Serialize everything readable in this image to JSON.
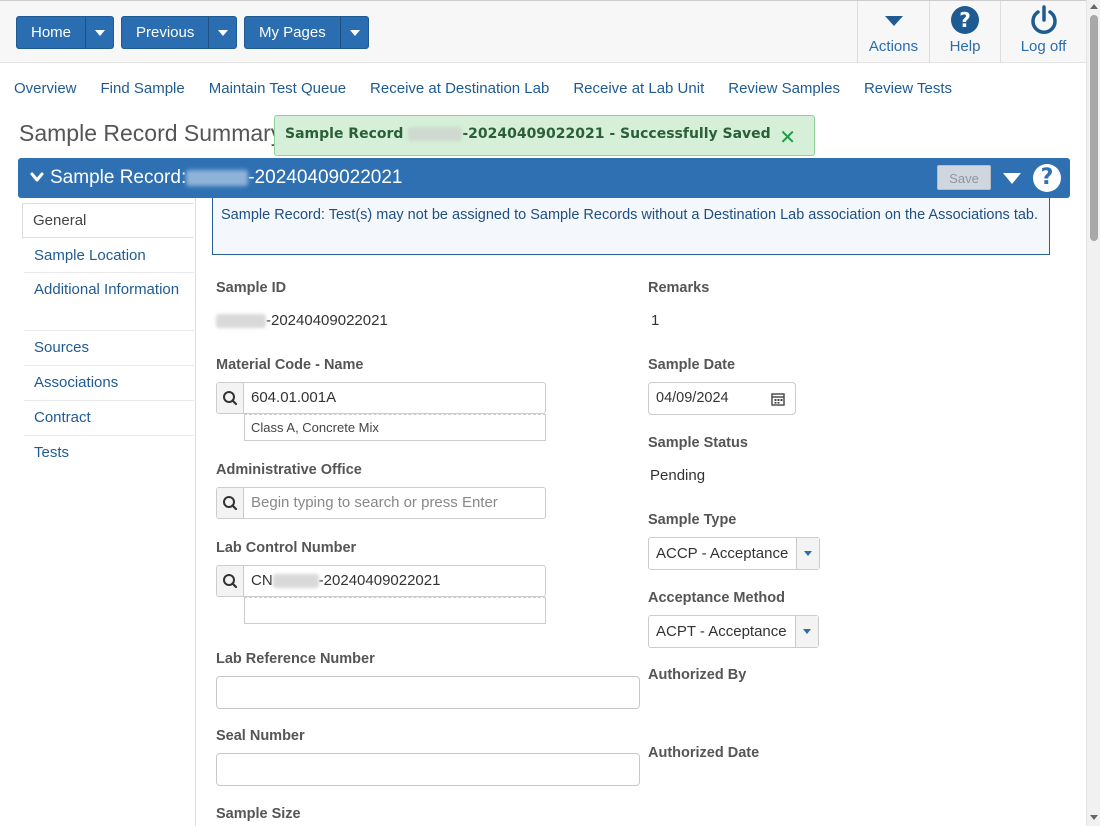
{
  "toolbar": {
    "home_label": "Home",
    "previous_label": "Previous",
    "mypages_label": "My Pages",
    "actions_label": "Actions",
    "help_label": "Help",
    "logoff_label": "Log off"
  },
  "nav": {
    "links": [
      "Overview",
      "Find Sample",
      "Maintain Test Queue",
      "Receive at Destination Lab",
      "Receive at Lab Unit",
      "Review Samples",
      "Review Tests"
    ]
  },
  "page": {
    "title": "Sample Record Summary"
  },
  "toast": {
    "prefix": "Sample Record",
    "suffix": "-20240409022021 - Successfully Saved",
    "close_glyph": "✕"
  },
  "record_header": {
    "prefix": "Sample Record:",
    "suffix": "-20240409022021",
    "save_label": "Save"
  },
  "tabs": [
    "General",
    "Sample Location",
    "Additional Information",
    "Sources",
    "Associations",
    "Contract",
    "Tests"
  ],
  "warning": {
    "text": "Sample Record: Test(s) may not be assigned to Sample Records without a Destination Lab association on the Associations tab."
  },
  "form": {
    "sample_id_label": "Sample ID",
    "sample_id_suffix": "-20240409022021",
    "material_label": "Material Code - Name",
    "material_code": "604.01.001A",
    "material_name": "Class A, Concrete Mix",
    "admin_office_label": "Administrative Office",
    "admin_office_placeholder": "Begin typing to search or press Enter",
    "lab_control_label": "Lab Control Number",
    "lab_control_prefix": "CN",
    "lab_control_suffix": "-20240409022021",
    "lab_ref_label": "Lab Reference Number",
    "seal_label": "Seal Number",
    "sample_size_label": "Sample Size",
    "remarks_label": "Remarks",
    "remarks_value": "1",
    "sample_date_label": "Sample Date",
    "sample_date_value": "04/09/2024",
    "sample_status_label": "Sample Status",
    "sample_status_value": "Pending",
    "sample_type_label": "Sample Type",
    "sample_type_value": "ACCP - Acceptance",
    "acceptance_method_label": "Acceptance Method",
    "acceptance_method_value": "ACPT - Acceptance",
    "authorized_by_label": "Authorized By",
    "authorized_date_label": "Authorized Date"
  },
  "colors": {
    "primary": "#2f70b3",
    "success_bg": "#d6efd8",
    "success_icon": "#1f9a45",
    "link": "#1f5b93"
  }
}
